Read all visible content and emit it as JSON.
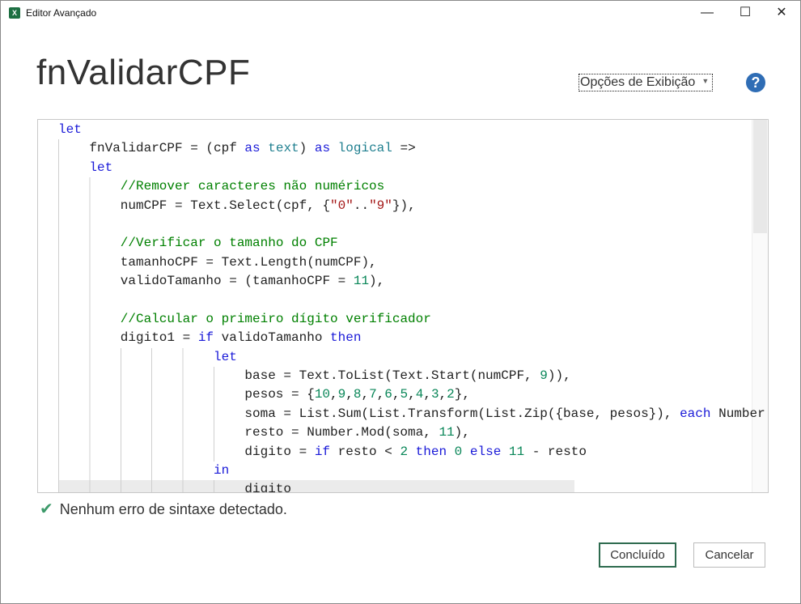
{
  "window": {
    "title": "Editor Avançado",
    "icon": "excel-icon",
    "controls": {
      "minimize": "—",
      "maximize": "☐",
      "close": "✕"
    }
  },
  "heading": "fnValidarCPF",
  "options_label": "Opções de Exibição",
  "help_label": "?",
  "colors": {
    "keyword": "#1a1ad8",
    "type": "#1f7f8f",
    "number": "#098658",
    "string": "#a31515",
    "comment": "#008000",
    "primary_border": "#2e6b4f"
  },
  "code_lines": [
    {
      "indent": 0,
      "tokens": [
        [
          "let",
          "k"
        ]
      ]
    },
    {
      "indent": 4,
      "tokens": [
        [
          "fnValidarCPF = (cpf ",
          ""
        ],
        [
          "as",
          "k"
        ],
        [
          " ",
          ""
        ],
        [
          "text",
          "t"
        ],
        [
          ") ",
          ""
        ],
        [
          "as",
          "k"
        ],
        [
          " ",
          ""
        ],
        [
          "logical",
          "t"
        ],
        [
          " =>",
          ""
        ]
      ]
    },
    {
      "indent": 4,
      "tokens": [
        [
          "let",
          "k"
        ]
      ]
    },
    {
      "indent": 8,
      "tokens": [
        [
          "//Remover caracteres não numéricos",
          "c"
        ]
      ]
    },
    {
      "indent": 8,
      "tokens": [
        [
          "numCPF = Text.Select(cpf, {",
          ""
        ],
        [
          "\"0\"",
          "s"
        ],
        [
          "..",
          ""
        ],
        [
          "\"9\"",
          "s"
        ],
        [
          "}),",
          ""
        ]
      ]
    },
    {
      "indent": 8,
      "tokens": []
    },
    {
      "indent": 8,
      "tokens": [
        [
          "//Verificar o tamanho do CPF",
          "c"
        ]
      ]
    },
    {
      "indent": 8,
      "tokens": [
        [
          "tamanhoCPF = Text.Length(numCPF),",
          ""
        ]
      ]
    },
    {
      "indent": 8,
      "tokens": [
        [
          "validoTamanho = (tamanhoCPF = ",
          ""
        ],
        [
          "11",
          "n"
        ],
        [
          "),",
          ""
        ]
      ]
    },
    {
      "indent": 8,
      "tokens": []
    },
    {
      "indent": 8,
      "tokens": [
        [
          "//Calcular o primeiro dígito verificador",
          "c"
        ]
      ]
    },
    {
      "indent": 8,
      "tokens": [
        [
          "digito1 = ",
          ""
        ],
        [
          "if",
          "k"
        ],
        [
          " validoTamanho ",
          ""
        ],
        [
          "then",
          "k"
        ]
      ]
    },
    {
      "indent": 20,
      "tokens": [
        [
          "let",
          "k"
        ]
      ]
    },
    {
      "indent": 24,
      "tokens": [
        [
          "base = Text.ToList(Text.Start(numCPF, ",
          ""
        ],
        [
          "9",
          "n"
        ],
        [
          ")),",
          ""
        ]
      ]
    },
    {
      "indent": 24,
      "tokens": [
        [
          "pesos = {",
          ""
        ],
        [
          "10",
          "n"
        ],
        [
          ",",
          ""
        ],
        [
          "9",
          "n"
        ],
        [
          ",",
          ""
        ],
        [
          "8",
          "n"
        ],
        [
          ",",
          ""
        ],
        [
          "7",
          "n"
        ],
        [
          ",",
          ""
        ],
        [
          "6",
          "n"
        ],
        [
          ",",
          ""
        ],
        [
          "5",
          "n"
        ],
        [
          ",",
          ""
        ],
        [
          "4",
          "n"
        ],
        [
          ",",
          ""
        ],
        [
          "3",
          "n"
        ],
        [
          ",",
          ""
        ],
        [
          "2",
          "n"
        ],
        [
          "},",
          ""
        ]
      ]
    },
    {
      "indent": 24,
      "tokens": [
        [
          "soma = List.Sum(List.Transform(List.Zip({base, pesos}), ",
          ""
        ],
        [
          "each",
          "k"
        ],
        [
          " Number",
          ""
        ]
      ]
    },
    {
      "indent": 24,
      "tokens": [
        [
          "resto = Number.Mod(soma, ",
          ""
        ],
        [
          "11",
          "n"
        ],
        [
          "),",
          ""
        ]
      ]
    },
    {
      "indent": 24,
      "tokens": [
        [
          "digito = ",
          ""
        ],
        [
          "if",
          "k"
        ],
        [
          " resto < ",
          ""
        ],
        [
          "2",
          "n"
        ],
        [
          " ",
          ""
        ],
        [
          "then",
          "k"
        ],
        [
          " ",
          ""
        ],
        [
          "0",
          "n"
        ],
        [
          " ",
          ""
        ],
        [
          "else",
          "k"
        ],
        [
          " ",
          ""
        ],
        [
          "11",
          "n"
        ],
        [
          " - resto",
          ""
        ]
      ]
    },
    {
      "indent": 20,
      "tokens": [
        [
          "in",
          "k"
        ]
      ]
    },
    {
      "indent": 24,
      "current": true,
      "tokens": [
        [
          "digito",
          ""
        ]
      ]
    }
  ],
  "status": {
    "icon": "checkmark-icon",
    "text": "Nenhum erro de sintaxe detectado."
  },
  "buttons": {
    "done": "Concluído",
    "cancel": "Cancelar"
  }
}
